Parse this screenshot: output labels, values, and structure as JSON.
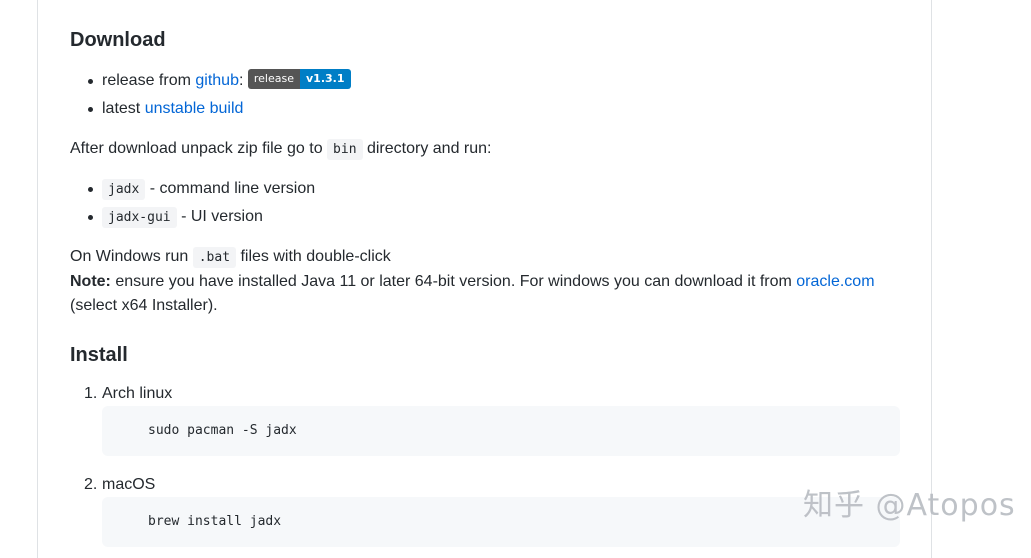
{
  "download": {
    "heading": "Download",
    "items": {
      "release_prefix": "release from ",
      "github_link": "github",
      "colon": ":",
      "badge_left": "release",
      "badge_right": "v1.3.1",
      "latest_prefix": "latest ",
      "unstable_link": "unstable build"
    },
    "after_text_1": "After download unpack zip file go to ",
    "after_code": "bin",
    "after_text_2": " directory and run:",
    "run_items": [
      {
        "code": "jadx",
        "text": " - command line version"
      },
      {
        "code": "jadx-gui",
        "text": " - UI version"
      }
    ],
    "windows_text_1": "On Windows run ",
    "windows_code": ".bat",
    "windows_text_2": " files with double-click",
    "note_label": "Note:",
    "note_text": " ensure you have installed Java 11 or later 64-bit version. For windows you can download it from ",
    "oracle_link": "oracle.com",
    "note_suffix": "(select x64 Installer)."
  },
  "install": {
    "heading": "Install",
    "steps": [
      {
        "num": "1.",
        "label": "Arch linux",
        "command": "sudo pacman -S jadx"
      },
      {
        "num": "2.",
        "label": "macOS",
        "command": "brew install jadx"
      }
    ]
  },
  "watermark": "知乎 @Atopos"
}
